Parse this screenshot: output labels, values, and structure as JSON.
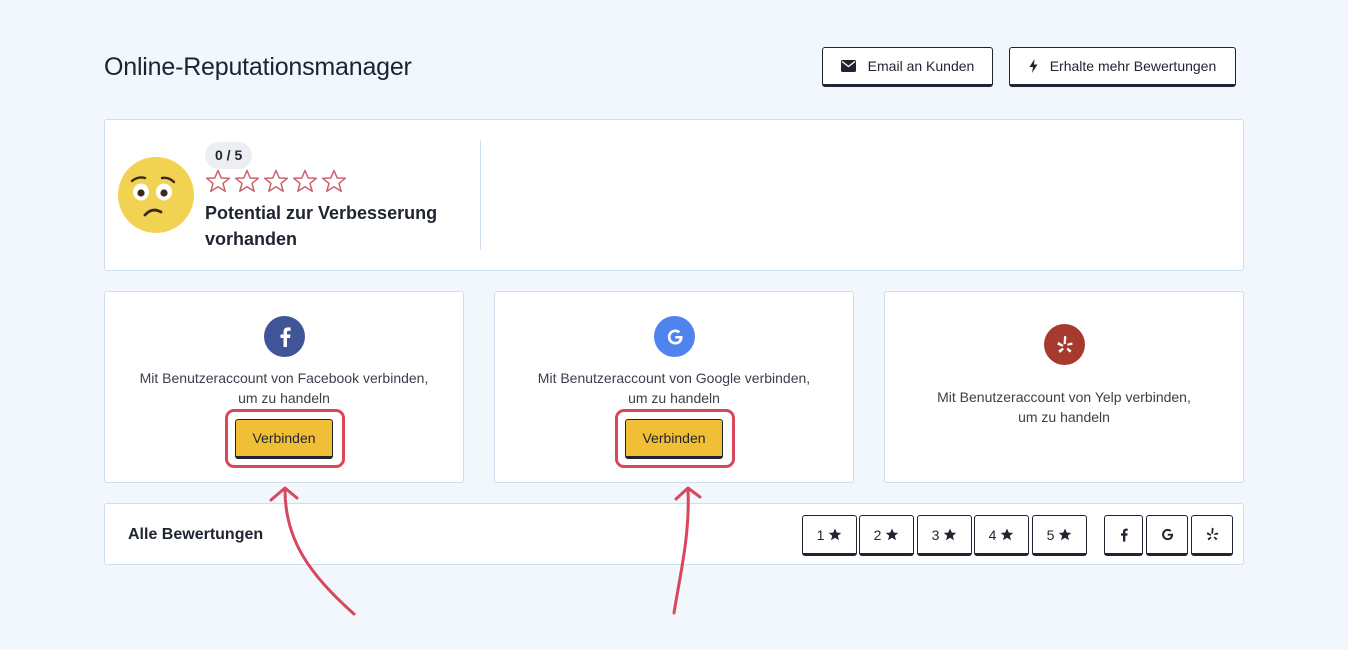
{
  "page": {
    "title": "Online-Reputationsmanager"
  },
  "header": {
    "email_label": "Email an Kunden",
    "reviews_label": "Erhalte mehr Bewertungen"
  },
  "summary": {
    "score": "0 / 5",
    "rating_value": 0,
    "rating_max": 5,
    "message": "Potential zur Verbesserung vorhanden"
  },
  "connectors": {
    "facebook": {
      "line1": "Mit Benutzeraccount von Facebook verbinden,",
      "line2": "um zu handeln",
      "button": "Verbinden",
      "color": "#3f5597",
      "icon": "facebook-icon"
    },
    "google": {
      "line1": "Mit Benutzeraccount von Google verbinden,",
      "line2": "um zu handeln",
      "button": "Verbinden",
      "color": "#4f84ee",
      "icon": "google-icon"
    },
    "yelp": {
      "line1": "Mit Benutzeraccount von Yelp verbinden,",
      "line2": "um zu handeln",
      "color": "#a63a2e",
      "icon": "yelp-icon"
    }
  },
  "reviews": {
    "title": "Alle Bewertungen",
    "star_filters": [
      "1",
      "2",
      "3",
      "4",
      "5"
    ],
    "source_filters": [
      "facebook-icon",
      "google-icon",
      "yelp-icon"
    ]
  },
  "colors": {
    "accent_button": "#f1bf35",
    "highlight": "#d8475c",
    "background": "#f1f7fd"
  }
}
